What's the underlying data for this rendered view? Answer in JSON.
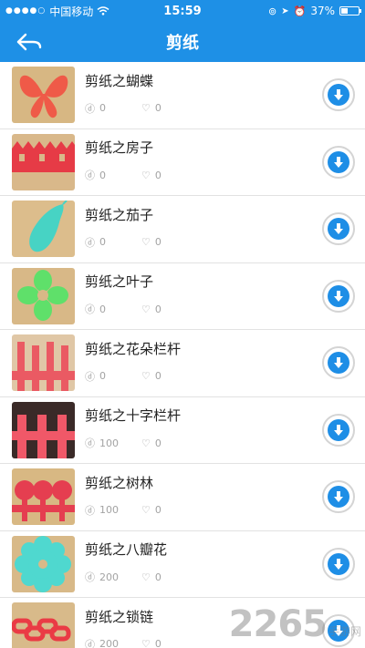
{
  "status": {
    "carrier": "中国移动",
    "time": "15:59",
    "battery": "37%",
    "battery_level": 0.37
  },
  "nav": {
    "title": "剪纸"
  },
  "colors": {
    "accent": "#1e90e6",
    "download": "#1e8ee6"
  },
  "items": [
    {
      "name": "剪纸之蝴蝶",
      "downloads": "0",
      "likes": "0"
    },
    {
      "name": "剪纸之房子",
      "downloads": "0",
      "likes": "0"
    },
    {
      "name": "剪纸之茄子",
      "downloads": "0",
      "likes": "0"
    },
    {
      "name": "剪纸之叶子",
      "downloads": "0",
      "likes": "0"
    },
    {
      "name": "剪纸之花朵栏杆",
      "downloads": "0",
      "likes": "0"
    },
    {
      "name": "剪纸之十字栏杆",
      "downloads": "100",
      "likes": "0"
    },
    {
      "name": "剪纸之树林",
      "downloads": "100",
      "likes": "0"
    },
    {
      "name": "剪纸之八瓣花",
      "downloads": "200",
      "likes": "0"
    },
    {
      "name": "剪纸之锁链",
      "downloads": "200",
      "likes": "0"
    }
  ],
  "watermark": {
    "text": "2265",
    "suffix": "手游网"
  }
}
